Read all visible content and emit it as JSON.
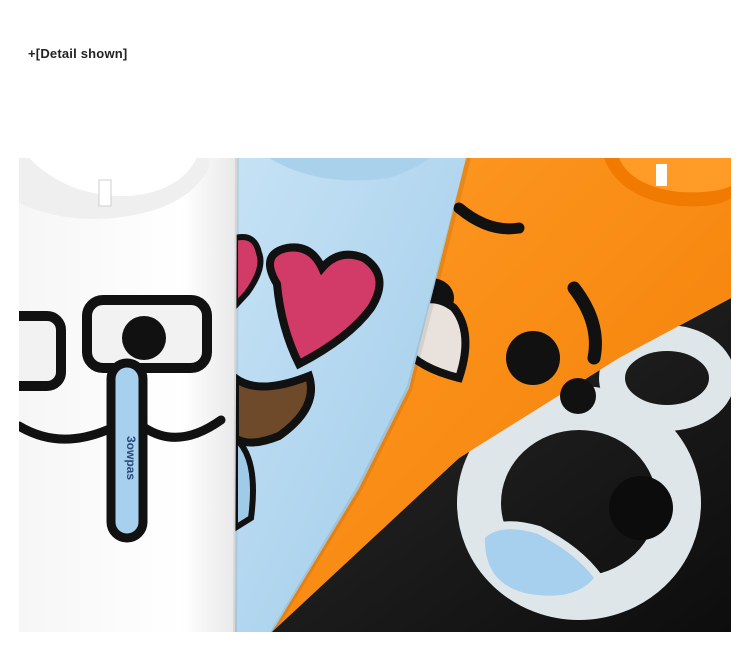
{
  "caption": {
    "text": "+[Detail shown]"
  },
  "photo": {
    "subject": "four printed t-shirts fanned out",
    "shirts": [
      {
        "color": "#ffffff",
        "print": "googly-eyes-face"
      },
      {
        "color": "#b9d9ef",
        "print": "heart-eyes-face"
      },
      {
        "color": "#ff8a12",
        "print": "winking-face"
      },
      {
        "color": "#151515",
        "print": "big-eyes-face"
      }
    ],
    "tag_text": "3owpas"
  }
}
